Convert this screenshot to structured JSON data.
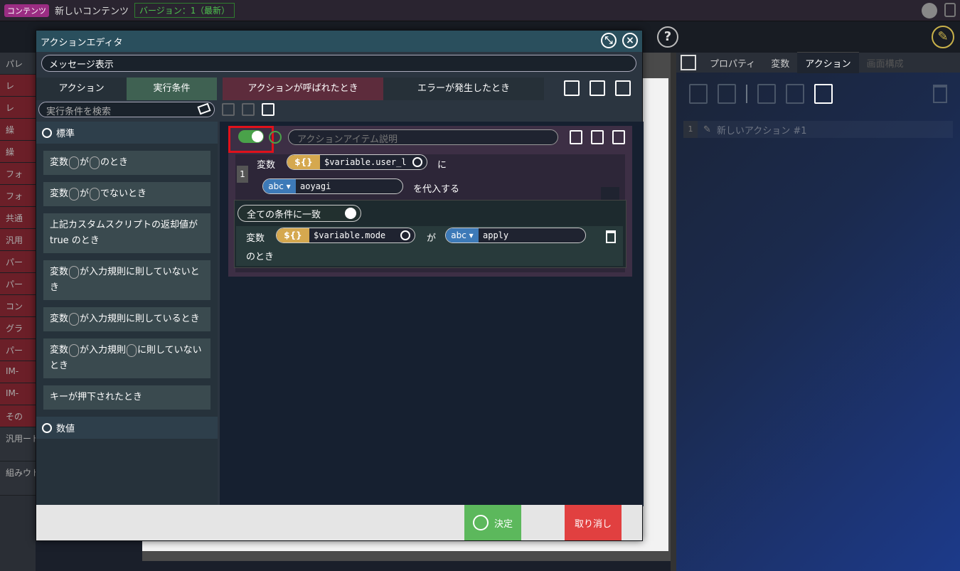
{
  "topbar": {
    "tag": "コンテンツ",
    "title": "新しいコンテンツ",
    "version": "バージョン：1（最新）"
  },
  "toolbar": {
    "help": "?"
  },
  "palette": {
    "items": [
      "レ",
      "レ",
      "繰",
      "繰",
      "フォ",
      "フォ",
      "共通",
      "汎用",
      "パー",
      "パー",
      "コン",
      "グラ",
      "パー",
      "IM-",
      "IM-",
      "その",
      "汎用ード）",
      "組みウトモ"
    ]
  },
  "modal": {
    "title": "アクションエディタ",
    "name": "メッセージ表示",
    "tabs": {
      "action": "アクション",
      "exec": "実行条件",
      "called": "アクションが呼ばれたとき",
      "error": "エラーが発生したとき"
    },
    "search_placeholder": "実行条件を検索",
    "categories": {
      "standard": "標準",
      "numeric": "数値"
    },
    "conditions": [
      [
        "変数",
        "が",
        "のとき"
      ],
      [
        "変数",
        "が",
        "でないとき"
      ],
      [
        "上記カスタムスクリプトの返却値が true のとき"
      ],
      [
        "変数",
        "が入力規則に則していないとき"
      ],
      [
        "変数",
        "が入力規則に則しているとき"
      ],
      [
        "変数",
        "が入力規則",
        "に則していないとき"
      ],
      [
        "キーが押下されたとき"
      ]
    ],
    "action_item": {
      "desc_placeholder": "アクションアイテム説明",
      "row_num": "1",
      "var_label": "変数",
      "var_tag": "${}",
      "var_value": "$variable.user_l",
      "ni": "に",
      "abc_tag": "abc ▾",
      "abc_value": "aoyagi",
      "assign": "を代入する",
      "match": "全ての条件に一致",
      "cond_var_label": "変数",
      "cond_var_value": "$variable.mode",
      "ga": "が",
      "cond_abc_value": "apply",
      "notoki": "のとき"
    },
    "footer": {
      "ok": "決定",
      "cancel": "取り消し"
    }
  },
  "right_panel": {
    "tabs": [
      "プロパティ",
      "変数",
      "アクション",
      "画面構成"
    ],
    "action_num": "1",
    "action_name": "新しいアクション #1"
  }
}
